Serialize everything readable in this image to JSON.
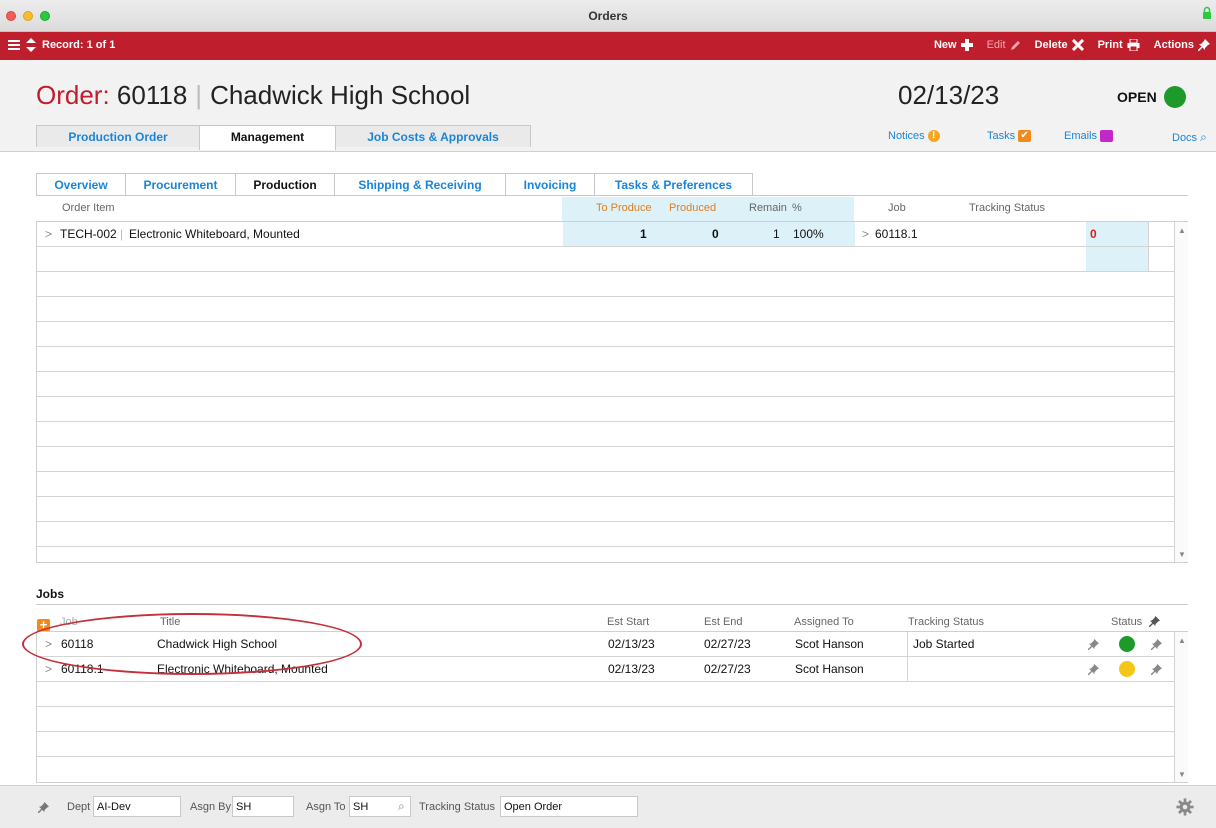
{
  "window": {
    "title": "Orders"
  },
  "toolbar": {
    "record": "Record: 1 of 1",
    "new_label": "New",
    "edit_label": "Edit",
    "delete_label": "Delete",
    "print_label": "Print",
    "actions_label": "Actions"
  },
  "header": {
    "order_label": "Order:",
    "order_number": "60118",
    "customer": "Chadwick High School",
    "date": "02/13/23",
    "status": "OPEN",
    "status_color": "#1e9a2b",
    "tabs": [
      "Production Order",
      "Management",
      "Job Costs & Approvals"
    ],
    "active_tab": "Management",
    "links": {
      "notices": "Notices",
      "tasks": "Tasks",
      "emails": "Emails",
      "docs": "Docs"
    }
  },
  "subtabs": {
    "items": [
      "Overview",
      "Procurement",
      "Production",
      "Shipping & Receiving",
      "Invoicing",
      "Tasks & Preferences"
    ],
    "active": "Production"
  },
  "production": {
    "columns": {
      "order_item": "Order Item",
      "to_produce": "To Produce",
      "produced": "Produced",
      "remain": "Remain",
      "percent": "%",
      "job": "Job",
      "tracking_status": "Tracking Status"
    },
    "rows": [
      {
        "item_code": "TECH-002",
        "item_name": "Electronic Whiteboard, Mounted",
        "to_produce": "1",
        "produced": "0",
        "remain": "1",
        "percent": "100%",
        "job": "60118.1",
        "flag": "0"
      }
    ]
  },
  "jobs": {
    "label": "Jobs",
    "columns": {
      "job": "Job",
      "title": "Title",
      "est_start": "Est Start",
      "est_end": "Est End",
      "assigned_to": "Assigned To",
      "tracking_status": "Tracking Status",
      "status": "Status"
    },
    "rows": [
      {
        "job": "60118",
        "title": "Chadwick High School",
        "est_start": "02/13/23",
        "est_end": "02/27/23",
        "assigned_to": "Scot Hanson",
        "tracking_status": "Job Started",
        "status_color": "#1e9a2b"
      },
      {
        "job": "60118.1",
        "title": "Electronic Whiteboard, Mounted",
        "est_start": "02/13/23",
        "est_end": "02/27/23",
        "assigned_to": "Scot Hanson",
        "tracking_status": "",
        "status_color": "#f5c518"
      }
    ]
  },
  "statusbar": {
    "dept_label": "Dept",
    "dept_value": "AI-Dev",
    "asgn_by_label": "Asgn By",
    "asgn_by_value": "SH",
    "asgn_to_label": "Asgn To",
    "asgn_to_value": "SH",
    "tracking_label": "Tracking Status",
    "tracking_value": "Open Order"
  }
}
